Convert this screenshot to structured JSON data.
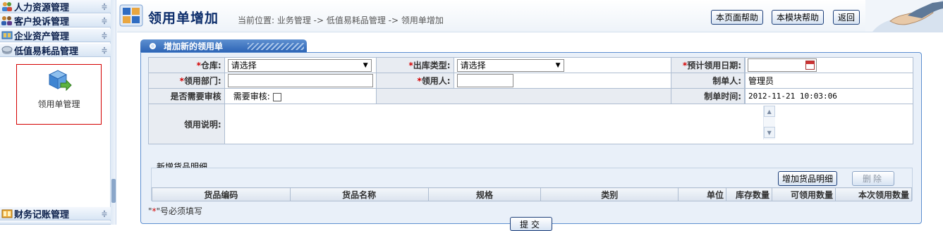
{
  "sidebar": {
    "sections": [
      {
        "label": "人力资源管理",
        "icon": "people-icon",
        "toggle": "≑"
      },
      {
        "label": "客户投诉管理",
        "icon": "customer-icon",
        "toggle": "≑"
      },
      {
        "label": "企业资产管理",
        "icon": "asset-icon",
        "toggle": "≑"
      },
      {
        "label": "低值易耗品管理",
        "icon": "consumables-icon",
        "toggle": "≑"
      },
      {
        "label": "财务记账管理",
        "icon": "finance-icon",
        "toggle": "≑"
      }
    ],
    "active_item": {
      "label": "领用单管理",
      "icon": "requisition-icon"
    }
  },
  "header": {
    "title": "领用单增加",
    "breadcrumb": "当前位置: 业务管理 -> 低值易耗品管理 -> 领用单增加",
    "buttons": {
      "page_help": "本页面帮助",
      "module_help": "本模块帮助",
      "back": "返回"
    }
  },
  "panel": {
    "tab_title": "增加新的领用单"
  },
  "form": {
    "required_mark": "*",
    "warehouse": {
      "label": "仓库:",
      "value": "请选择"
    },
    "outbound_type": {
      "label": "出库类型:",
      "value": "请选择"
    },
    "expected_date": {
      "label": "预计领用日期:",
      "value": ""
    },
    "department": {
      "label": "领用部门:",
      "value": ""
    },
    "recipient": {
      "label": "领用人:",
      "value": ""
    },
    "creator": {
      "label": "制单人:",
      "value": "管理员"
    },
    "need_review": {
      "label": "是否需要审核",
      "checkbox_label": "需要审核:",
      "checked": false
    },
    "created_time": {
      "label": "制单时间:",
      "value": "2012-11-21 10:03:06"
    },
    "description": {
      "label": "领用说明:",
      "value": ""
    }
  },
  "detail": {
    "title": "新增货品明细",
    "add_button": "增加货品明细",
    "delete_button": "删除",
    "columns": [
      "货品编码",
      "货品名称",
      "规格",
      "类别",
      "单位",
      "库存数量",
      "可领用数量",
      "本次领用数量"
    ],
    "rows": []
  },
  "footer": {
    "required_star": "*",
    "required_note_prefix": "\"",
    "required_note_suffix": "\"号必须填写",
    "submit_button": "提交"
  }
}
